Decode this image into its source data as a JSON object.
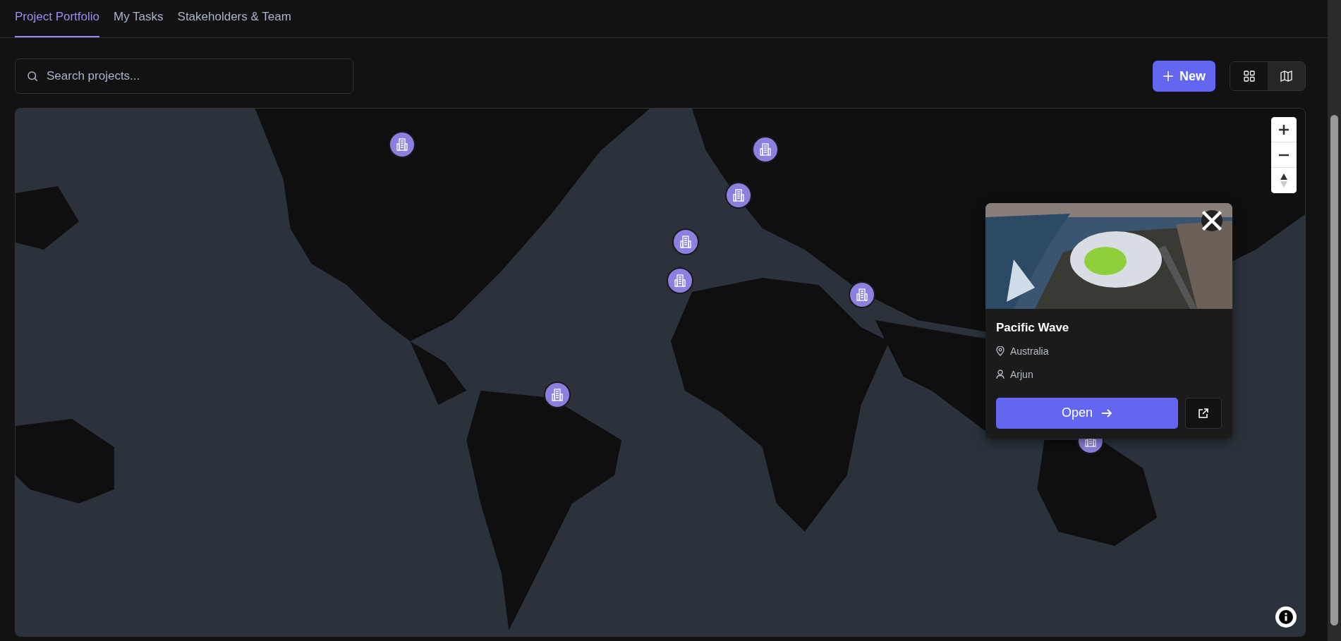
{
  "tabs": [
    {
      "label": "Project Portfolio",
      "selected": true
    },
    {
      "label": "My Tasks",
      "selected": false
    },
    {
      "label": "Stakeholders & Team",
      "selected": false
    }
  ],
  "search": {
    "placeholder": "Search projects..."
  },
  "new_button": {
    "label": "New"
  },
  "view_toggle": [
    {
      "kind": "grid",
      "selected": false
    },
    {
      "kind": "map",
      "selected": true
    }
  ],
  "popup": {
    "title": "Pacific Wave",
    "location": "Australia",
    "owner": "Arjun",
    "open_button": "Open"
  }
}
